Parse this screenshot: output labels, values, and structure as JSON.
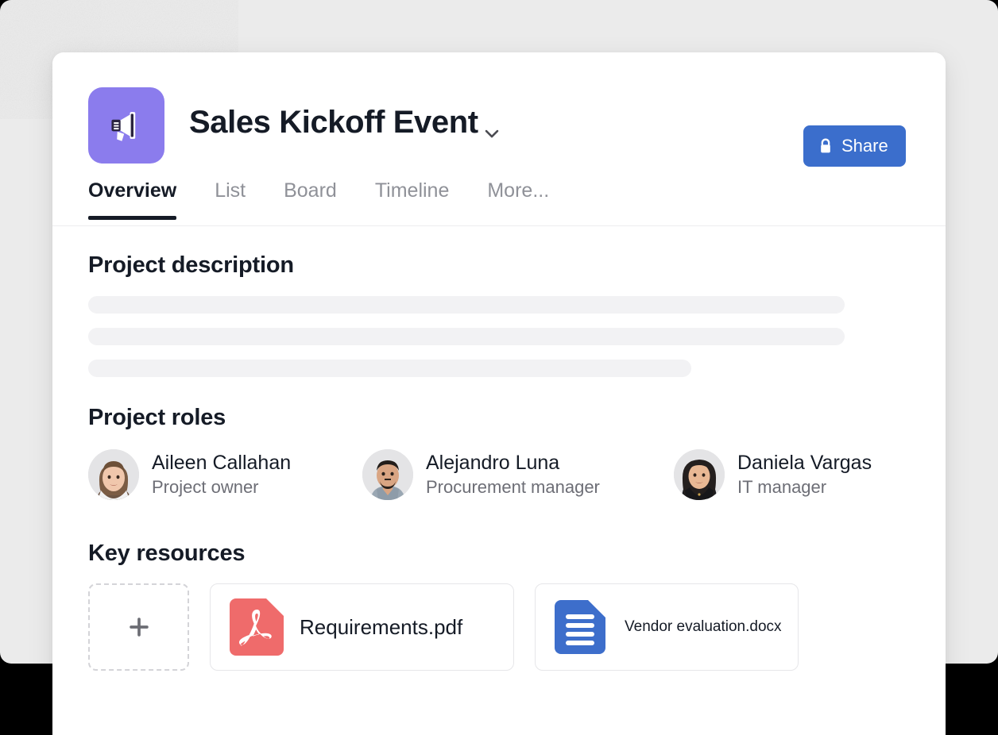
{
  "window": {
    "background_color": "#ebebeb",
    "card_background": "#ffffff"
  },
  "header": {
    "project_icon": "megaphone-icon",
    "project_icon_color": "#8b7ced",
    "title": "Sales Kickoff Event",
    "title_dropdown_icon": "chevron-down-icon",
    "share": {
      "label": "Share",
      "icon": "lock-icon",
      "color": "#3b6ecc"
    }
  },
  "tabs": [
    {
      "label": "Overview",
      "active": true
    },
    {
      "label": "List",
      "active": false
    },
    {
      "label": "Board",
      "active": false
    },
    {
      "label": "Timeline",
      "active": false
    },
    {
      "label": "More...",
      "active": false
    }
  ],
  "sections": {
    "description": {
      "title": "Project description",
      "placeholder_lines": 3
    },
    "roles": {
      "title": "Project roles",
      "people": [
        {
          "name": "Aileen Callahan",
          "role": "Project owner",
          "avatar": "avatar-woman-brown-hair"
        },
        {
          "name": "Alejandro Luna",
          "role": "Procurement manager",
          "avatar": "avatar-man-beard"
        },
        {
          "name": "Daniela Vargas",
          "role": "IT manager",
          "avatar": "avatar-woman-dark-hair"
        }
      ]
    },
    "resources": {
      "title": "Key resources",
      "add_label": "+",
      "items": [
        {
          "name": "Requirements.pdf",
          "icon": "pdf-file-icon",
          "icon_color": "#ef6b6b"
        },
        {
          "name": "Vendor evaluation.docx",
          "icon": "doc-file-icon",
          "icon_color": "#3d6ecb"
        }
      ]
    }
  }
}
